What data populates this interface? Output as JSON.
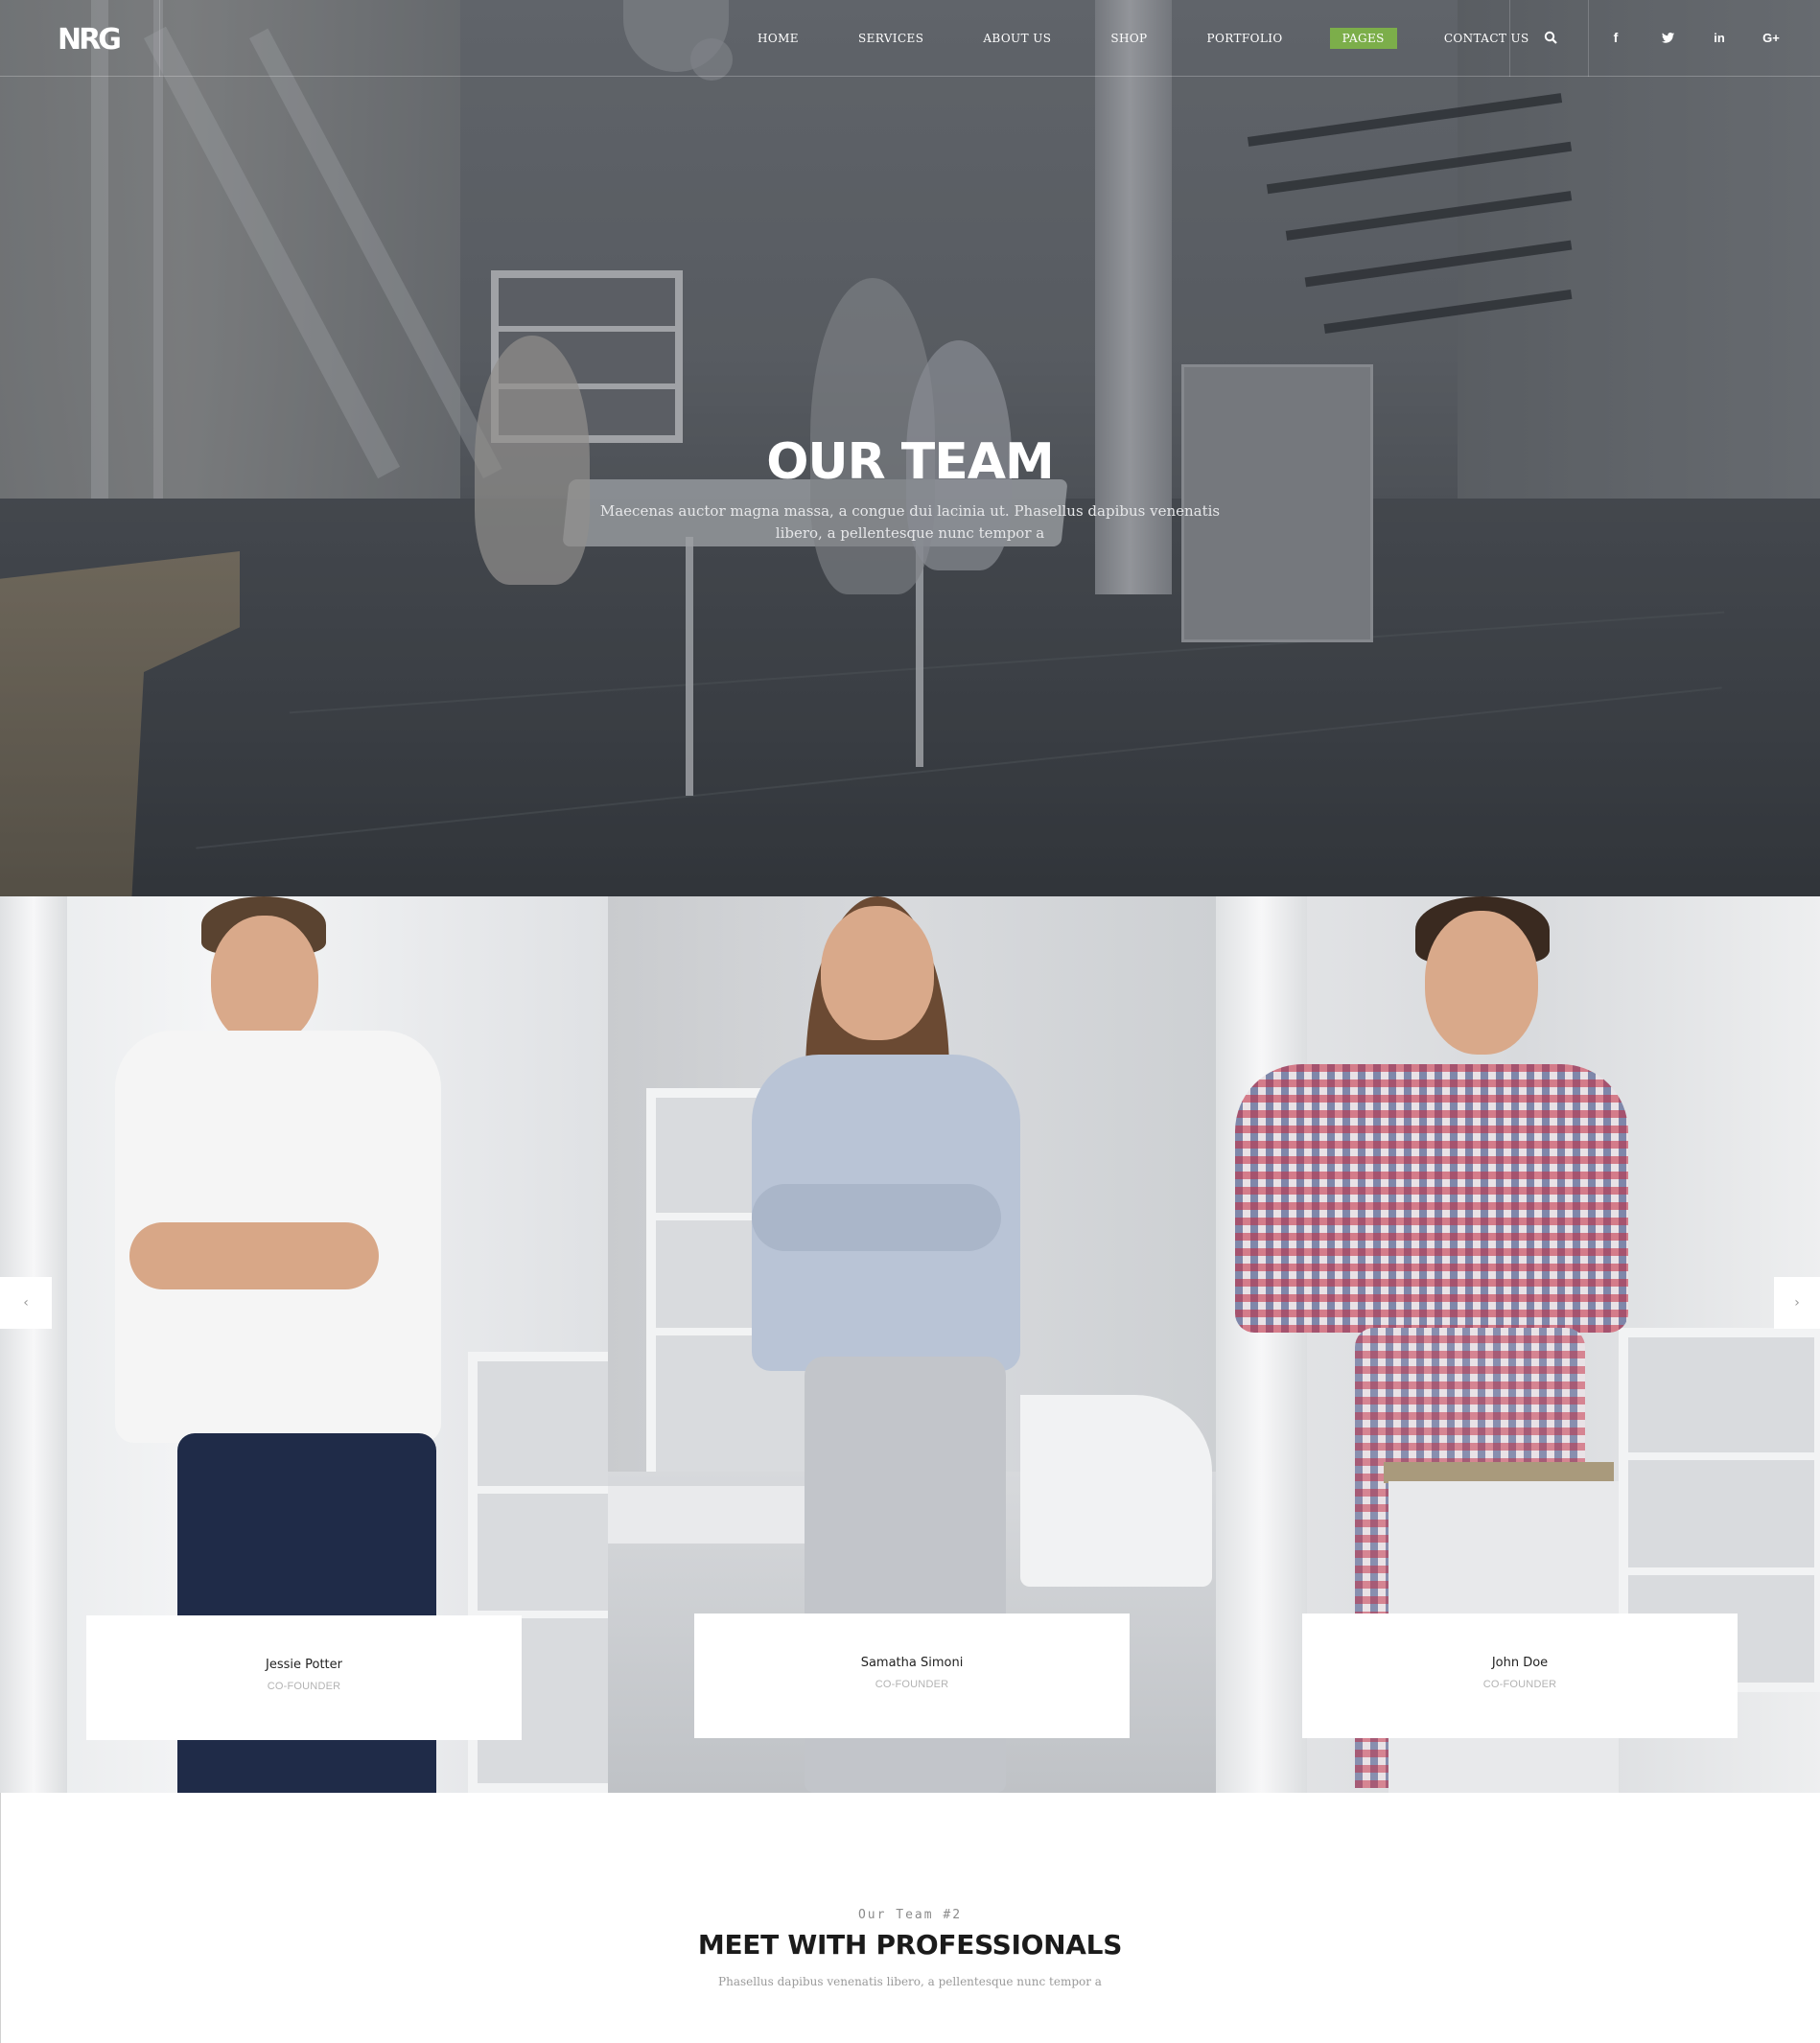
{
  "brand": {
    "logo_text": "NRG"
  },
  "nav": {
    "items": [
      {
        "label": "HOME",
        "active": false
      },
      {
        "label": "SERVICES",
        "active": false
      },
      {
        "label": "ABOUT US",
        "active": false
      },
      {
        "label": "SHOP",
        "active": false
      },
      {
        "label": "PORTFOLIO",
        "active": false
      },
      {
        "label": "PAGES",
        "active": true
      },
      {
        "label": "CONTACT US",
        "active": false
      }
    ],
    "icons": {
      "search": "search-icon",
      "facebook": "f",
      "twitter": "twitter-icon",
      "linkedin": "in",
      "googleplus": "G+"
    },
    "accent_color": "#7cae4a"
  },
  "hero": {
    "title": "OUR TEAM",
    "subtitle": "Maecenas auctor magna massa, a congue dui lacinia ut. Phasellus dapibus venenatis libero, a pellentesque nunc tempor a"
  },
  "team": {
    "members": [
      {
        "name": "Jessie Potter",
        "role": "CO-FOUNDER"
      },
      {
        "name": "Samatha Simoni",
        "role": "CO-FOUNDER"
      },
      {
        "name": "John Doe",
        "role": "CO-FOUNDER"
      }
    ],
    "prev_arrow": "‹",
    "next_arrow": "›"
  },
  "section2": {
    "pre_title": "Our Team #2",
    "title": "MEET WITH PROFESSIONALS",
    "subtitle": "Phasellus dapibus venenatis libero, a pellentesque nunc tempor a"
  }
}
